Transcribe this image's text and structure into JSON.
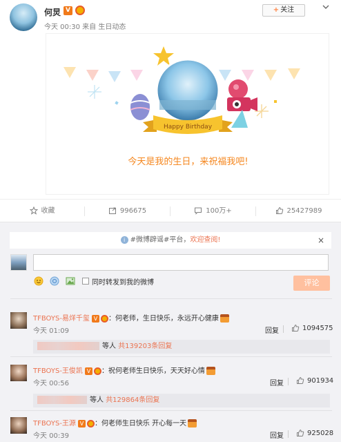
{
  "post": {
    "author": "何炅",
    "verified_badge": "V",
    "meta": "今天 00:30 来自 生日动态",
    "follow_label": "关注",
    "follow_plus": "+"
  },
  "card": {
    "ribbon_text": "Happy Birthday",
    "message": "今天是我的生日，来祝福我吧!"
  },
  "actions": {
    "collect_label": "收藏",
    "repost_count": "996675",
    "comment_count": "100万+",
    "like_count": "25427989"
  },
  "comment_box": {
    "notice_prefix": "#微博辟谣#平台，",
    "notice_highlight": "欢迎查阅!",
    "notice_icon": "i",
    "close_icon": "×",
    "repost_label": "同时转发到我的微博",
    "submit_label": "评论"
  },
  "comments": [
    {
      "user": "TFBOYS-易烊千玺",
      "badge": "V",
      "text": "：何老师，生日快乐，永远开心健康",
      "time": "今天 01:09",
      "reply_label": "回复",
      "likes": "1094575",
      "replies_suffix": "等人",
      "replies_link": "共139203条回复"
    },
    {
      "user": "TFBOYS-王俊凯",
      "badge": "V",
      "text": "：祝何老师生日快乐，天天好心情",
      "time": "今天 00:56",
      "reply_label": "回复",
      "likes": "901934",
      "replies_suffix": "等人",
      "replies_link": "共129864条回复"
    },
    {
      "user": "TFBOYS-王源",
      "badge": "V",
      "text": "：何老师生日快乐  开心每一天",
      "time": "今天 00:39",
      "reply_label": "回复",
      "likes": "925028"
    }
  ],
  "colors": {
    "accent": "#eb7350",
    "orange": "#f5871f",
    "submit_disabled": "#ffc09f"
  }
}
